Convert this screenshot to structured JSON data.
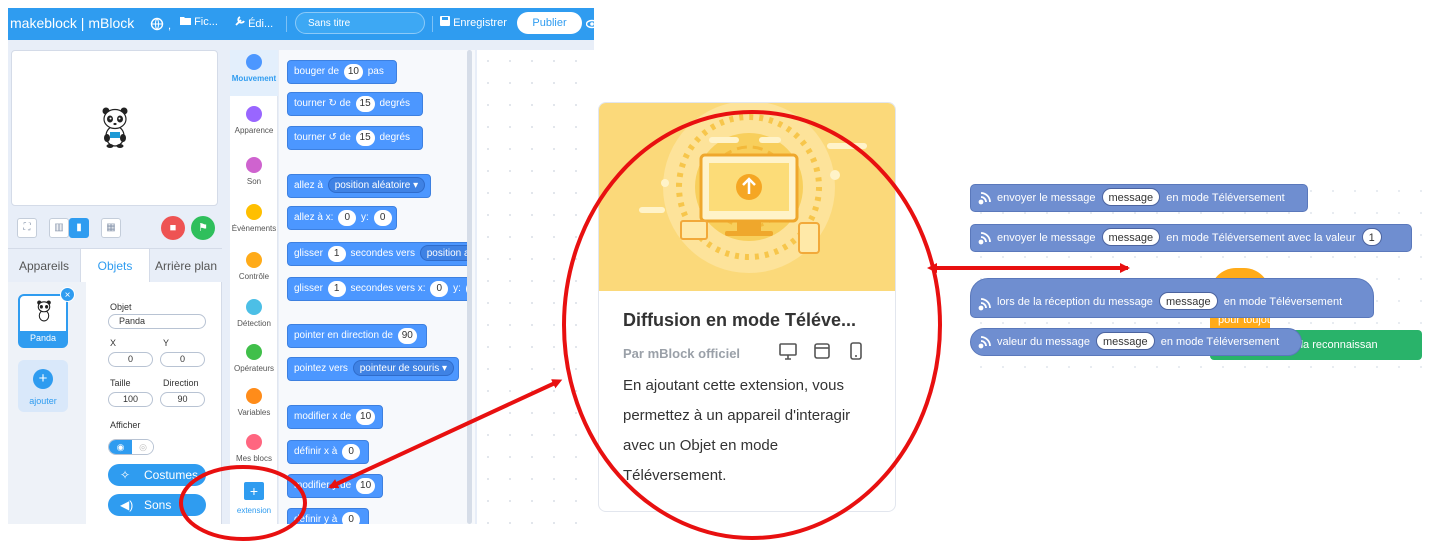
{
  "topbar": {
    "brand": "makeblock | mBlock",
    "file_menu": "Fic...",
    "edit_menu": "Édi...",
    "project_title": "Sans titre",
    "save_label": "Enregistrer",
    "publish_label": "Publier"
  },
  "stage": {
    "sprite_icon": "panda-sprite"
  },
  "tabs": [
    "Appareils",
    "Objets",
    "Arrière plan"
  ],
  "sprite_list": {
    "sprite_name": "Panda",
    "add_label": "ajouter"
  },
  "properties": {
    "object_label": "Objet",
    "object_value": "Panda",
    "x_label": "X",
    "x_value": "0",
    "y_label": "Y",
    "y_value": "0",
    "size_label": "Taille",
    "size_value": "100",
    "direction_label": "Direction",
    "direction_value": "90",
    "show_label": "Afficher",
    "costumes_label": "Costumes",
    "sounds_label": "Sons"
  },
  "categories": [
    {
      "label": "Mouvement",
      "color": "#4c97ff"
    },
    {
      "label": "Apparence",
      "color": "#9966ff"
    },
    {
      "label": "Son",
      "color": "#cf63cf"
    },
    {
      "label": "Évènements",
      "color": "#ffbf00"
    },
    {
      "label": "Contrôle",
      "color": "#ffab19"
    },
    {
      "label": "Détection",
      "color": "#4cbfe6"
    },
    {
      "label": "Opérateurs",
      "color": "#40bf4a"
    },
    {
      "label": "Variables",
      "color": "#ff8c1a"
    },
    {
      "label": "Mes blocs",
      "color": "#ff6680"
    }
  ],
  "extension_button_label": "extension",
  "blocks": {
    "move": {
      "a": "bouger de",
      "v": "10",
      "b": "pas"
    },
    "turn_right": {
      "a": "tourner",
      "b": "de",
      "v": "15",
      "c": "degrés"
    },
    "turn_left": {
      "a": "tourner",
      "b": "de",
      "v": "15",
      "c": "degrés"
    },
    "goto": {
      "a": "allez à",
      "d": "position aléatoire ▾"
    },
    "goto_xy": {
      "a": "allez à x:",
      "x": "0",
      "b": "y:",
      "y": "0"
    },
    "glide_to": {
      "a": "glisser",
      "v": "1",
      "b": "secondes vers",
      "d": "position alé"
    },
    "glide_xy": {
      "a": "glisser",
      "v": "1",
      "b": "secondes vers x:",
      "x": "0",
      "c": "y:",
      "y": "0"
    },
    "point_dir": {
      "a": "pointer en direction de",
      "v": "90"
    },
    "point_to": {
      "a": "pointez vers",
      "d": "pointeur de souris ▾"
    },
    "change_x": {
      "a": "modifier x de",
      "v": "10"
    },
    "set_x": {
      "a": "définir x à",
      "v": "0"
    },
    "change_y": {
      "a": "modifier y de",
      "v": "10"
    },
    "set_y": {
      "a": "définir y à",
      "v": "0"
    }
  },
  "extension_card": {
    "title": "Diffusion en mode Téléve...",
    "author": "Par mBlock officiel",
    "device_icons": [
      "desktop-icon",
      "window-icon",
      "mobile-icon"
    ],
    "description": "En ajoutant cette extension, vous permettez à un appareil d'interagir avec un Objet en mode Téléversement."
  },
  "upload_blocks": {
    "send": {
      "a": "envoyer le message",
      "m": "message",
      "b": "en mode Téléversement"
    },
    "send_value": {
      "a": "envoyer le message",
      "m": "message",
      "b": "en mode Téléversement avec la valeur",
      "v": "1"
    },
    "on_receive": {
      "a": "lors de la réception du message",
      "m": "message",
      "b": "en mode Téléversement"
    },
    "value_of": {
      "a": "valeur du message",
      "m": "message",
      "b": "en mode Téléversement"
    },
    "behind_forever": "pour toujours",
    "behind_result": "tat de la reconnaissan"
  },
  "colors": {
    "accent": "#2f9cf0",
    "annotation": "#e81010",
    "upload_block": "#6f8ed0"
  }
}
